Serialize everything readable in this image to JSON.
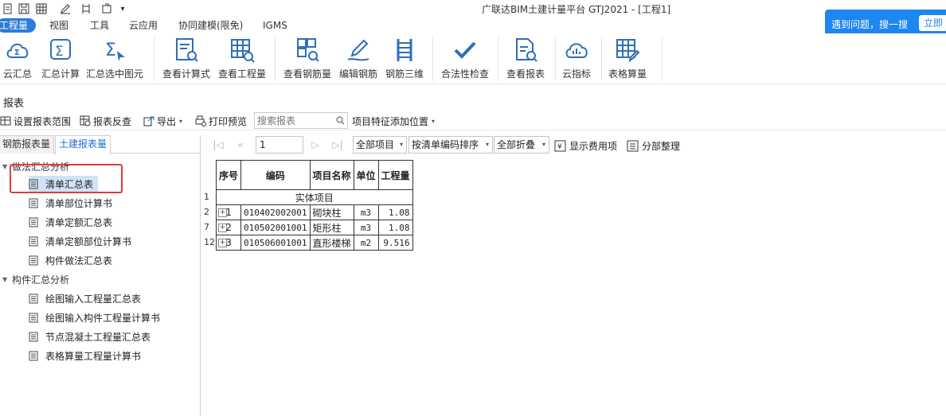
{
  "app_title": "广联达BIM土建计量平台 GTJ2021 - [工程1]",
  "quick_access": [
    "new-icon",
    "save-icon",
    "grid-icon",
    "edit-icon",
    "rebar-icon",
    "export-icon",
    "dropdown-icon"
  ],
  "menu": {
    "tabs": [
      "工程量",
      "视图",
      "工具",
      "云应用",
      "协同建模(限免)",
      "IGMS"
    ],
    "active": "工程量"
  },
  "help": {
    "text": "遇到问题，搜一搜",
    "button": "立即"
  },
  "ribbon": {
    "buttons": [
      {
        "label": "云汇总",
        "icon": "cloud-sum-icon"
      },
      {
        "label": "汇总计算",
        "icon": "sum-icon"
      },
      {
        "label": "汇总选中图元",
        "icon": "sum-selected-icon"
      },
      {
        "label": "查看计算式",
        "icon": "view-formula-icon"
      },
      {
        "label": "查看工程量",
        "icon": "view-quantity-icon"
      },
      {
        "label": "查看钢筋量",
        "icon": "view-rebar-icon"
      },
      {
        "label": "编辑钢筋",
        "icon": "edit-rebar-icon"
      },
      {
        "label": "钢筋三维",
        "icon": "rebar-3d-icon"
      },
      {
        "label": "合法性检查",
        "icon": "check-icon"
      },
      {
        "label": "查看报表",
        "icon": "view-report-icon"
      },
      {
        "label": "云指标",
        "icon": "cloud-index-icon"
      },
      {
        "label": "表格算量",
        "icon": "table-calc-icon"
      }
    ]
  },
  "panel_title": "报表",
  "toolbar": {
    "set_range": "设置报表范围",
    "reverse_check": "报表反查",
    "export": "导出",
    "print_preview": "打印预览",
    "search_placeholder": "搜索报表",
    "feature_position": "项目特征添加位置"
  },
  "left_panel": {
    "tabs": [
      "钢筋报表量",
      "土建报表量"
    ],
    "active_tab": "土建报表量",
    "groups": [
      {
        "label": "做法汇总分析",
        "items": [
          "清单汇总表",
          "清单部位计算书",
          "清单定额汇总表",
          "清单定额部位计算书",
          "构件做法汇总表"
        ]
      },
      {
        "label": "构件汇总分析",
        "items": [
          "绘图输入工程量汇总表",
          "绘图输入构件工程量计算书",
          "节点混凝土工程量汇总表",
          "表格算量工程量计算书"
        ]
      }
    ],
    "selected_item": "清单汇总表"
  },
  "report_toolbar": {
    "page": "1",
    "scope": "全部项目",
    "sort": "按清单编码排序",
    "fold": "全部折叠",
    "show_cost": "显示费用项",
    "organize": "分部整理"
  },
  "report_table": {
    "headers": [
      "序号",
      "编码",
      "项目名称",
      "单位",
      "工程量"
    ],
    "section": {
      "row_num": "1",
      "label": "实体项目"
    },
    "rows": [
      {
        "row_num": "2",
        "seq": "1",
        "code": "010402002001",
        "name": "砌块柱",
        "unit": "m3",
        "qty": "1.08"
      },
      {
        "row_num": "7",
        "seq": "2",
        "code": "010502001001",
        "name": "矩形柱",
        "unit": "m3",
        "qty": "1.08"
      },
      {
        "row_num": "12",
        "seq": "3",
        "code": "010506001001",
        "name": "直形楼梯",
        "unit": "m2",
        "qty": "9.516"
      }
    ]
  },
  "colors": {
    "accent": "#2b7bd8",
    "help_bg": "#1e86f0",
    "selected": "#cfe3f8",
    "highlight_box": "#e03a3a",
    "icon": "#2e6fb8"
  }
}
